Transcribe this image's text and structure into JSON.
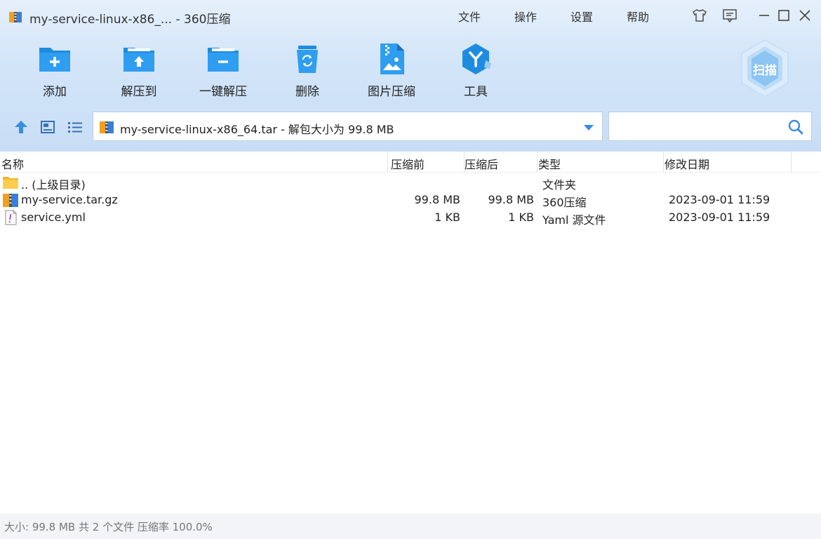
{
  "window": {
    "title": "my-service-linux-x86_... - 360压缩"
  },
  "menu": {
    "file": "文件",
    "operate": "操作",
    "settings": "设置",
    "help": "帮助"
  },
  "toolbar": {
    "add": "添加",
    "extract_to": "解压到",
    "one_click_extract": "一键解压",
    "delete": "删除",
    "image_compress": "图片压缩",
    "tools": "工具",
    "scan": "扫描"
  },
  "pathbar": {
    "text": "my-service-linux-x86_64.tar - 解包大小为 99.8 MB"
  },
  "search": {
    "placeholder": ""
  },
  "columns": {
    "name": "名称",
    "before": "压缩前",
    "after": "压缩后",
    "type": "类型",
    "modified": "修改日期"
  },
  "files": [
    {
      "name": ".. (上级目录)",
      "before": "",
      "after": "",
      "type": "文件夹",
      "modified": "",
      "icon": "folder-icon"
    },
    {
      "name": "my-service.tar.gz",
      "before": "99.8 MB",
      "after": "99.8 MB",
      "type": "360压缩",
      "modified": "2023-09-01 11:59",
      "icon": "archive-icon"
    },
    {
      "name": "service.yml",
      "before": "1 KB",
      "after": "1 KB",
      "type": "Yaml 源文件",
      "modified": "2023-09-01 11:59",
      "icon": "yaml-file-icon"
    }
  ],
  "status": {
    "text": "大小: 99.8 MB 共 2 个文件 压缩率 100.0%"
  },
  "colors": {
    "accent": "#1e8be0",
    "top_bg": "#d3e5f8"
  }
}
